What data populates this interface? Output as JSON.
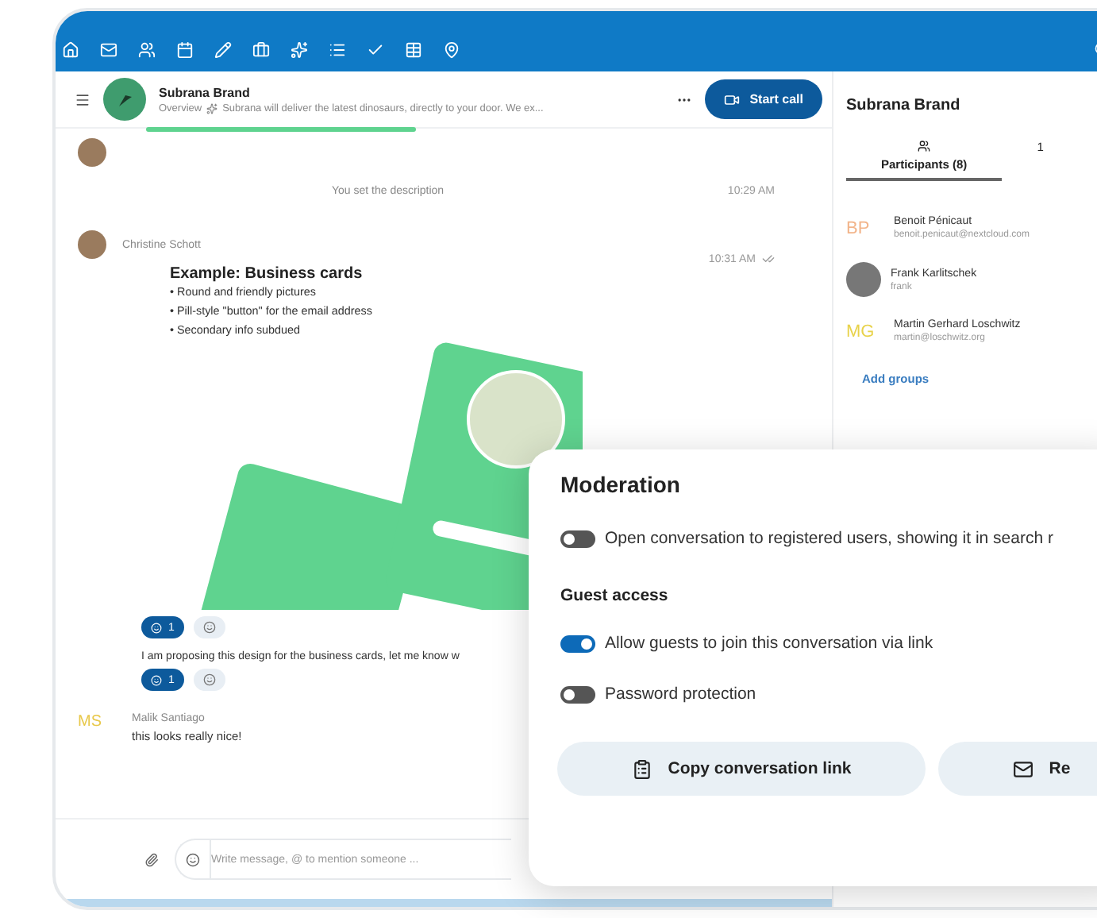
{
  "conversation": {
    "name": "Subrana Brand",
    "overview": "Overview",
    "description": "Subrana will deliver the latest dinosaurs, directly to your door. We ex...",
    "start_call": "Start call"
  },
  "messages": [
    {
      "kind": "system",
      "text": "You set the description",
      "time": "10:29 AM"
    },
    {
      "kind": "post",
      "author": "Christine Schott",
      "time": "10:31 AM",
      "read": true,
      "title": "Example: Business cards",
      "bullets": [
        "• Round and friendly pictures",
        "• Pill-style \"button\" for the email address",
        "• Secondary info subdued"
      ],
      "reactions": [
        {
          "count": "1",
          "selected": true
        }
      ]
    },
    {
      "kind": "text",
      "text": "I am proposing this design for the business cards, let me know w",
      "reactions": [
        {
          "count": "1",
          "selected": true
        }
      ]
    },
    {
      "kind": "initials",
      "initials": "MS",
      "color": "#e8c84a",
      "author": "Malik Santiago",
      "text": "this looks really nice!"
    }
  ],
  "composer": {
    "placeholder": "Write message, @ to mention someone ..."
  },
  "sidebar": {
    "title": "Subrana Brand",
    "tabs": [
      {
        "label": "Participants (8)",
        "selected": true
      },
      {
        "label": "1",
        "selected": false
      }
    ],
    "participants": [
      {
        "kind": "initials",
        "initials": "BP",
        "color": "#f2b48a",
        "name": "Benoit Pénicaut",
        "detail": "benoit.penicaut@nextcloud.com"
      },
      {
        "kind": "photo",
        "name": "Frank Karlitschek",
        "detail": "frank"
      },
      {
        "kind": "initials",
        "initials": "MG",
        "color": "#e8d24a",
        "name": "Martin Gerhard Loschwitz",
        "detail": "martin@loschwitz.org"
      }
    ],
    "add_groups": "Add groups"
  },
  "moderation": {
    "title": "Moderation",
    "toggles": [
      {
        "label": "Open conversation to registered users, showing it in search r",
        "on": false
      }
    ],
    "guest_title": "Guest access",
    "guest_toggles": [
      {
        "label": "Allow guests to join this conversation via link",
        "on": true
      },
      {
        "label": "Password protection",
        "on": false
      }
    ],
    "buttons": [
      {
        "kind": "copy",
        "label": "Copy conversation link"
      },
      {
        "kind": "mail",
        "label": "Re"
      }
    ]
  }
}
